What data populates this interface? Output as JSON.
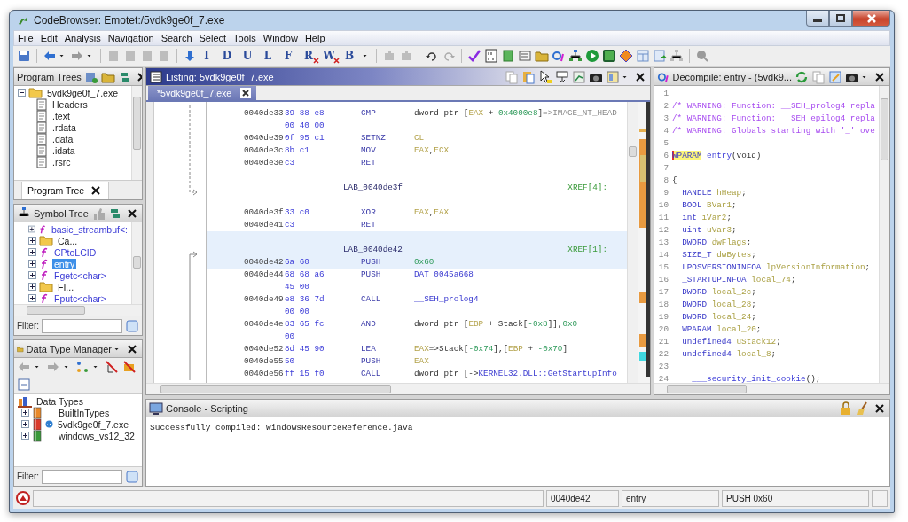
{
  "window": {
    "title": "CodeBrowser: Emotet:/5vdk9ge0f_7.exe"
  },
  "menu": [
    "File",
    "Edit",
    "Analysis",
    "Navigation",
    "Search",
    "Select",
    "Tools",
    "Window",
    "Help"
  ],
  "toolbar_letters": [
    {
      "glyph": "I",
      "crossed": false
    },
    {
      "glyph": "D",
      "crossed": false
    },
    {
      "glyph": "U",
      "crossed": false
    },
    {
      "glyph": "L",
      "crossed": false
    },
    {
      "glyph": "F",
      "crossed": false
    },
    {
      "glyph": "R",
      "crossed": true
    },
    {
      "glyph": "W",
      "crossed": true
    },
    {
      "glyph": "B",
      "crossed": false
    }
  ],
  "program_trees": {
    "title": "Program Trees",
    "focused": false,
    "root": {
      "label": "5vdk9ge0f_7.exe",
      "expanded": true,
      "children": [
        {
          "label": "Headers"
        },
        {
          "label": ".text"
        },
        {
          "label": ".rdata"
        },
        {
          "label": ".data"
        },
        {
          "label": ".idata"
        },
        {
          "label": ".rsrc"
        }
      ]
    },
    "tabs": [
      {
        "label": "Program Tree",
        "selected": true
      }
    ]
  },
  "symbol_tree": {
    "title": "Symbol Tree",
    "focused": false,
    "items": [
      {
        "kind": "function",
        "label": "basic_streambuf<:",
        "selected": false
      },
      {
        "kind": "folder",
        "label": "Ca...",
        "selected": false
      },
      {
        "kind": "function",
        "label": "CPtoLCID",
        "selected": false
      },
      {
        "kind": "function",
        "label": "entry",
        "selected": true
      },
      {
        "kind": "function",
        "label": "Fgetc<char>",
        "selected": false
      },
      {
        "kind": "folder",
        "label": "FI...",
        "selected": false
      },
      {
        "kind": "function",
        "label": "Fputc<char>",
        "selected": false
      }
    ],
    "filter_label": "Filter:"
  },
  "data_type_manager": {
    "title": "Data Type Manager",
    "focused": false,
    "root": {
      "label": "Data Types",
      "children": [
        {
          "label": "BuiltInTypes",
          "color": "#e8892a",
          "verified": false
        },
        {
          "label": "5vdk9ge0f_7.exe",
          "color": "#d93a2b",
          "verified": true
        },
        {
          "label": "windows_vs12_32",
          "color": "#3a9a3a",
          "verified": false
        }
      ]
    },
    "filter_label": "Filter:"
  },
  "listing": {
    "title": "Listing:  5vdk9ge0f_7.exe",
    "focused": true,
    "tabs": [
      {
        "label": "*5vdk9ge0f_7.exe",
        "selected": true
      }
    ],
    "rows": [
      {
        "kind": "instr",
        "highlighted": false,
        "address": "0040de33",
        "bytes": "39 88 e8",
        "mnemonic": "CMP",
        "operands": [
          {
            "kind": "plain",
            "text": "dword ptr ["
          },
          {
            "kind": "reg",
            "text": "EAX"
          },
          {
            "kind": "plain",
            "text": " + "
          },
          {
            "kind": "num",
            "text": "0x4000e8"
          },
          {
            "kind": "plain",
            "text": "]"
          },
          {
            "kind": "ref",
            "text": "=>IMAGE_NT_HEAD"
          }
        ]
      },
      {
        "kind": "cont",
        "highlighted": false,
        "bytes": "00 40 00"
      },
      {
        "kind": "instr",
        "highlighted": false,
        "address": "0040de39",
        "bytes": "0f 95 c1",
        "mnemonic": "SETNZ",
        "operands": [
          {
            "kind": "reg",
            "text": "CL"
          }
        ]
      },
      {
        "kind": "instr",
        "highlighted": false,
        "address": "0040de3c",
        "bytes": "8b c1",
        "mnemonic": "MOV",
        "operands": [
          {
            "kind": "reg",
            "text": "EAX"
          },
          {
            "kind": "plain",
            "text": ","
          },
          {
            "kind": "reg",
            "text": "ECX"
          }
        ]
      },
      {
        "kind": "instr",
        "highlighted": false,
        "address": "0040de3e",
        "bytes": "c3",
        "mnemonic": "RET"
      },
      {
        "kind": "blank",
        "highlighted": false
      },
      {
        "kind": "label",
        "highlighted": false,
        "label": "LAB_0040de3f",
        "xref": "XREF[4]:"
      },
      {
        "kind": "blank",
        "highlighted": false
      },
      {
        "kind": "instr",
        "highlighted": false,
        "address": "0040de3f",
        "bytes": "33 c0",
        "mnemonic": "XOR",
        "operands": [
          {
            "kind": "reg",
            "text": "EAX"
          },
          {
            "kind": "plain",
            "text": ","
          },
          {
            "kind": "reg",
            "text": "EAX"
          }
        ]
      },
      {
        "kind": "instr",
        "highlighted": false,
        "address": "0040de41",
        "bytes": "c3",
        "mnemonic": "RET"
      },
      {
        "kind": "blank",
        "highlighted": true
      },
      {
        "kind": "label",
        "highlighted": true,
        "label": "LAB_0040de42",
        "xref": "XREF[1]:"
      },
      {
        "kind": "instr",
        "highlighted": true,
        "address": "0040de42",
        "bytes": "6a 60",
        "mnemonic": "PUSH",
        "operands": [
          {
            "kind": "num",
            "text": "0x60"
          }
        ]
      },
      {
        "kind": "instr",
        "highlighted": false,
        "address": "0040de44",
        "bytes": "68 68 a6",
        "mnemonic": "PUSH",
        "operands": [
          {
            "kind": "sym",
            "text": "DAT_0045a668"
          }
        ]
      },
      {
        "kind": "cont",
        "highlighted": false,
        "bytes": "45 00"
      },
      {
        "kind": "instr",
        "highlighted": false,
        "address": "0040de49",
        "bytes": "e8 36 7d",
        "mnemonic": "CALL",
        "operands": [
          {
            "kind": "sym",
            "text": "__SEH_prolog4"
          }
        ]
      },
      {
        "kind": "cont",
        "highlighted": false,
        "bytes": "00 00"
      },
      {
        "kind": "instr",
        "highlighted": false,
        "address": "0040de4e",
        "bytes": "83 65 fc",
        "mnemonic": "AND",
        "operands": [
          {
            "kind": "plain",
            "text": "dword ptr ["
          },
          {
            "kind": "reg",
            "text": "EBP"
          },
          {
            "kind": "plain",
            "text": " + Stack["
          },
          {
            "kind": "num",
            "text": "-0x8"
          },
          {
            "kind": "plain",
            "text": "]],"
          },
          {
            "kind": "num",
            "text": "0x0"
          }
        ]
      },
      {
        "kind": "cont",
        "highlighted": false,
        "bytes": "00"
      },
      {
        "kind": "instr",
        "highlighted": false,
        "address": "0040de52",
        "bytes": "8d 45 90",
        "mnemonic": "LEA",
        "operands": [
          {
            "kind": "reg",
            "text": "EAX"
          },
          {
            "kind": "plain",
            "text": "=>Stack["
          },
          {
            "kind": "num",
            "text": "-0x74"
          },
          {
            "kind": "plain",
            "text": "],["
          },
          {
            "kind": "reg",
            "text": "EBP"
          },
          {
            "kind": "plain",
            "text": " + "
          },
          {
            "kind": "num",
            "text": "-0x70"
          },
          {
            "kind": "plain",
            "text": "]"
          }
        ]
      },
      {
        "kind": "instr",
        "highlighted": false,
        "address": "0040de55",
        "bytes": "50",
        "mnemonic": "PUSH",
        "operands": [
          {
            "kind": "reg",
            "text": "EAX"
          }
        ]
      },
      {
        "kind": "instr",
        "highlighted": false,
        "address": "0040de56",
        "bytes": "ff 15 f0",
        "mnemonic": "CALL",
        "operands": [
          {
            "kind": "plain",
            "text": "dword ptr [->"
          },
          {
            "kind": "sym",
            "text": "KERNEL32.DLL::GetStartupInfo"
          }
        ]
      }
    ]
  },
  "decompile": {
    "title": "Decompile: entry -  (5vdk9...",
    "focused": false,
    "lines": [
      {
        "n": "1"
      },
      {
        "n": "2",
        "tokens": [
          {
            "kind": "comment",
            "text": "/* WARNING: Function: __SEH_prolog4 repla"
          }
        ]
      },
      {
        "n": "3",
        "tokens": [
          {
            "kind": "comment",
            "text": "/* WARNING: Function: __SEH_epilog4 repla"
          }
        ]
      },
      {
        "n": "4",
        "tokens": [
          {
            "kind": "comment",
            "text": "/* WARNING: Globals starting with '_' ove"
          }
        ]
      },
      {
        "n": "5"
      },
      {
        "n": "6",
        "tokens": [
          {
            "kind": "type",
            "text": "WPARAM",
            "highlighted": true
          },
          {
            "kind": "func",
            "text": " entry"
          },
          {
            "kind": "plain",
            "text": "(void)"
          }
        ]
      },
      {
        "n": "7"
      },
      {
        "n": "8",
        "tokens": [
          {
            "kind": "plain",
            "text": "{"
          }
        ]
      },
      {
        "n": "9",
        "tokens": [
          {
            "kind": "type",
            "text": "  HANDLE"
          },
          {
            "kind": "var",
            "text": " hHeap"
          },
          {
            "kind": "plain",
            "text": ";"
          }
        ]
      },
      {
        "n": "10",
        "tokens": [
          {
            "kind": "type",
            "text": "  BOOL"
          },
          {
            "kind": "var",
            "text": " BVar1"
          },
          {
            "kind": "plain",
            "text": ";"
          }
        ]
      },
      {
        "n": "11",
        "tokens": [
          {
            "kind": "type",
            "text": "  int"
          },
          {
            "kind": "var",
            "text": " iVar2"
          },
          {
            "kind": "plain",
            "text": ";"
          }
        ]
      },
      {
        "n": "12",
        "tokens": [
          {
            "kind": "type",
            "text": "  uint"
          },
          {
            "kind": "var",
            "text": " uVar3"
          },
          {
            "kind": "plain",
            "text": ";"
          }
        ]
      },
      {
        "n": "13",
        "tokens": [
          {
            "kind": "type",
            "text": "  DWORD"
          },
          {
            "kind": "var",
            "text": " dwFlags"
          },
          {
            "kind": "plain",
            "text": ";"
          }
        ]
      },
      {
        "n": "14",
        "tokens": [
          {
            "kind": "type",
            "text": "  SIZE_T"
          },
          {
            "kind": "var",
            "text": " dwBytes"
          },
          {
            "kind": "plain",
            "text": ";"
          }
        ]
      },
      {
        "n": "15",
        "tokens": [
          {
            "kind": "type",
            "text": "  LPOSVERSIONINFOA"
          },
          {
            "kind": "var",
            "text": " lpVersionInformation"
          },
          {
            "kind": "plain",
            "text": ";"
          }
        ]
      },
      {
        "n": "16",
        "tokens": [
          {
            "kind": "type",
            "text": "  _STARTUPINFOA"
          },
          {
            "kind": "var",
            "text": " local_74"
          },
          {
            "kind": "plain",
            "text": ";"
          }
        ]
      },
      {
        "n": "17",
        "tokens": [
          {
            "kind": "type",
            "text": "  DWORD"
          },
          {
            "kind": "var",
            "text": " local_2c"
          },
          {
            "kind": "plain",
            "text": ";"
          }
        ]
      },
      {
        "n": "18",
        "tokens": [
          {
            "kind": "type",
            "text": "  DWORD"
          },
          {
            "kind": "var",
            "text": " local_28"
          },
          {
            "kind": "plain",
            "text": ";"
          }
        ]
      },
      {
        "n": "19",
        "tokens": [
          {
            "kind": "type",
            "text": "  DWORD"
          },
          {
            "kind": "var",
            "text": " local_24"
          },
          {
            "kind": "plain",
            "text": ";"
          }
        ]
      },
      {
        "n": "20",
        "tokens": [
          {
            "kind": "type",
            "text": "  WPARAM"
          },
          {
            "kind": "var",
            "text": " local_20"
          },
          {
            "kind": "plain",
            "text": ";"
          }
        ]
      },
      {
        "n": "21",
        "tokens": [
          {
            "kind": "type",
            "text": "  undefined4"
          },
          {
            "kind": "var",
            "text": " uStack12"
          },
          {
            "kind": "plain",
            "text": ";"
          }
        ]
      },
      {
        "n": "22",
        "tokens": [
          {
            "kind": "type",
            "text": "  undefined4"
          },
          {
            "kind": "var",
            "text": " local_8"
          },
          {
            "kind": "plain",
            "text": ";"
          }
        ]
      },
      {
        "n": "23"
      },
      {
        "n": "24",
        "tokens": [
          {
            "kind": "func",
            "text": "    ___security_init_cookie"
          },
          {
            "kind": "plain",
            "text": "();"
          }
        ]
      }
    ]
  },
  "console": {
    "title": "Console - Scripting",
    "focused": false,
    "output": "Successfully compiled: WindowsResourceReference.java"
  },
  "status_bar": {
    "address": "0040de42",
    "function": "entry",
    "instruction": "PUSH 0x60"
  }
}
